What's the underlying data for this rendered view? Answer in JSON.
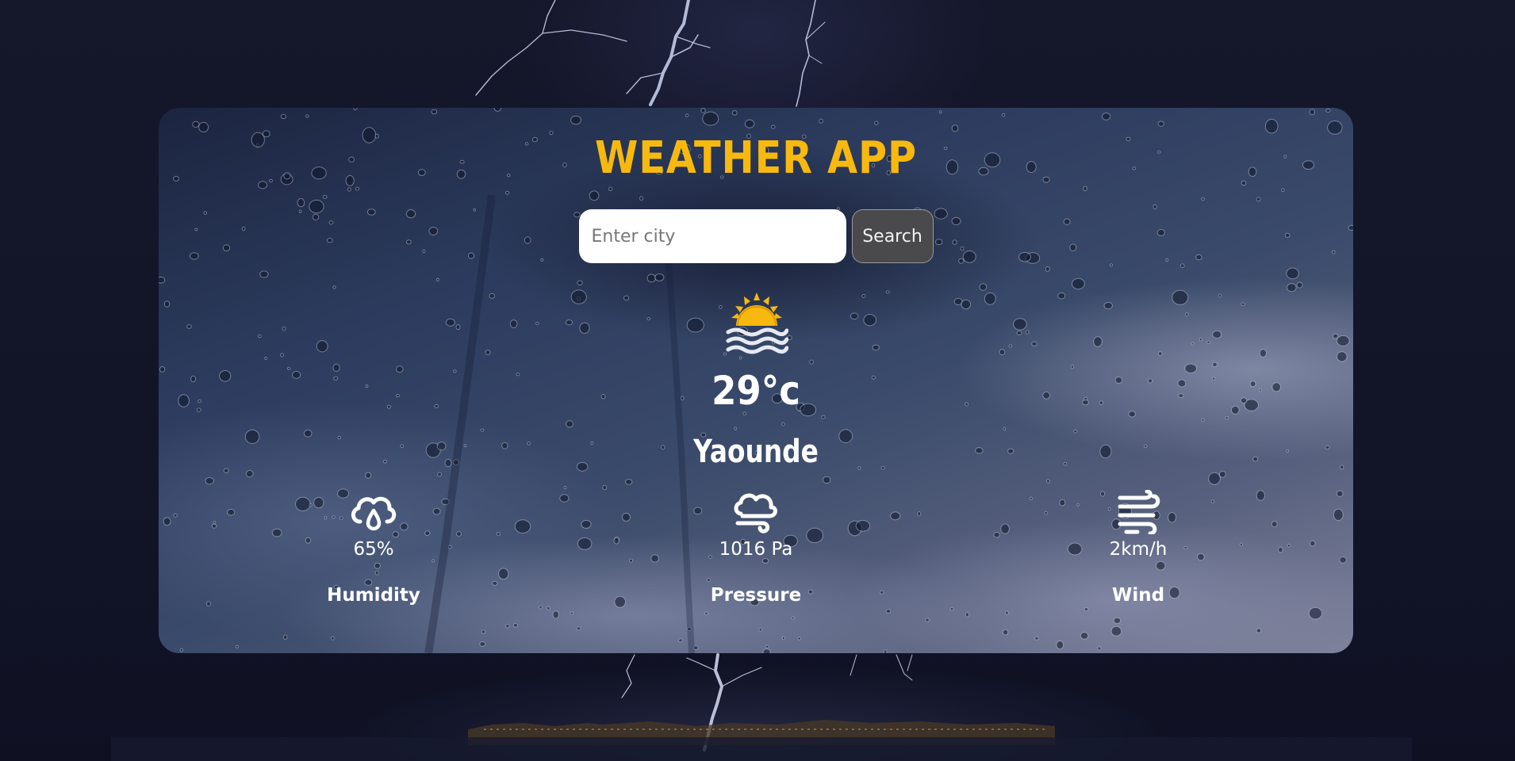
{
  "app": {
    "title": "WEATHER APP"
  },
  "search": {
    "placeholder": "Enter city",
    "value": "",
    "button_label": "Search"
  },
  "current": {
    "icon": "sun-over-water-icon",
    "temperature": "29°c",
    "city": "Yaounde"
  },
  "details": [
    {
      "icon": "cloud-droplet-icon",
      "value": "65%",
      "label": "Humidity"
    },
    {
      "icon": "cloud-wind-icon",
      "value": "1016 Pa",
      "label": "Pressure"
    },
    {
      "icon": "wind-icon",
      "value": "2km/h",
      "label": "Wind"
    }
  ],
  "colors": {
    "accent": "#f7b90f",
    "page_background": "#14162a",
    "button_background": "#4a4a4c",
    "text": "#ffffff"
  }
}
